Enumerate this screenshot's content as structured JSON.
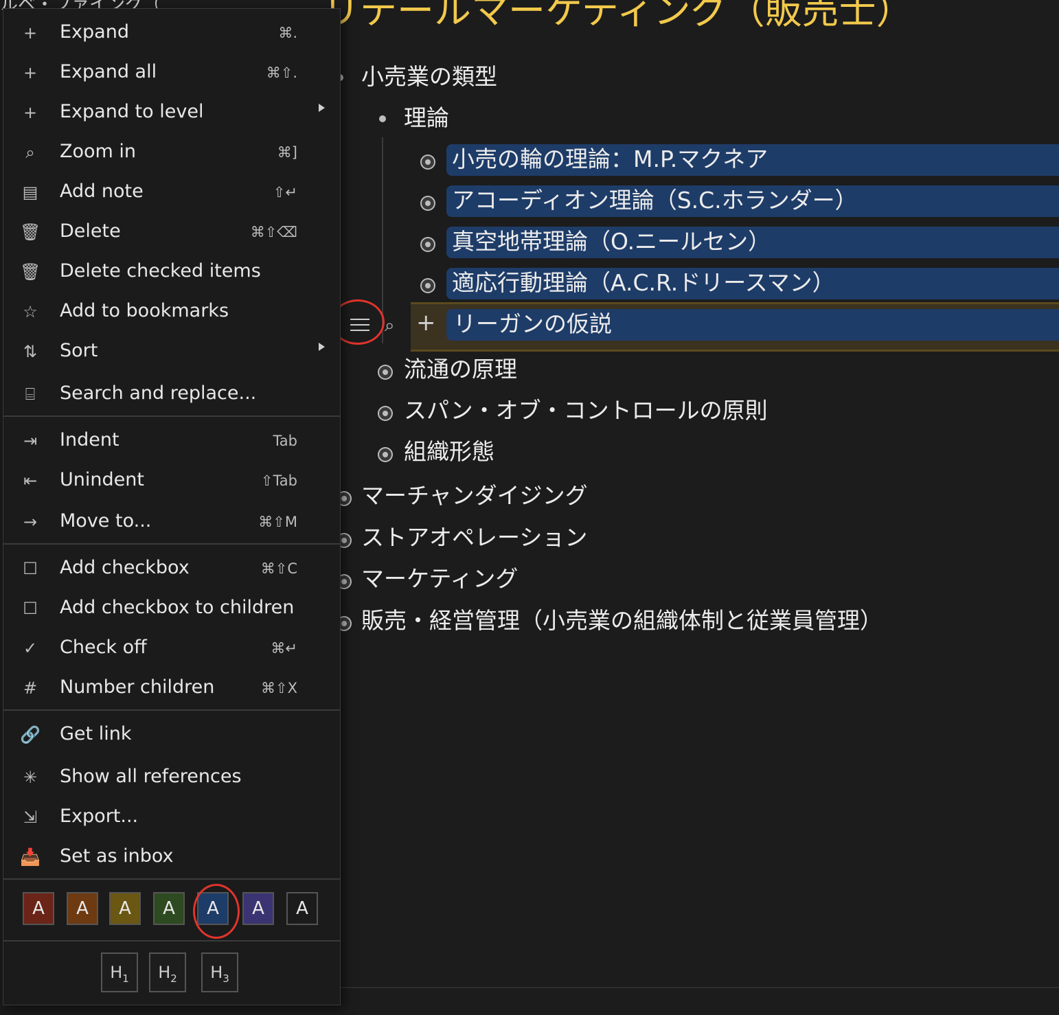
{
  "breadcrumb": "ルベ・ファイング（",
  "title": "リテールマーケティング（販売士）",
  "outline": {
    "root": "小売業の類型",
    "sub": "理論",
    "theories": [
      "小売の輪の理論：M.P.マクネア",
      "アコーディオン理論（S.C.ホランダー）",
      "真空地帯理論（O.ニールセン）",
      "適応行動理論（A.C.R.ドリースマン）"
    ],
    "selected": "リーガンの仮説",
    "siblings": [
      "流通の原理",
      "スパン・オブ・コントロールの原則",
      "組織形態"
    ],
    "top_items": [
      "マーチャンダイジング",
      "ストアオペレーション",
      "マーケティング",
      "販売・経営管理（小売業の組織体制と従業員管理）"
    ]
  },
  "menu": {
    "items": [
      {
        "icon": "+",
        "label": "Expand",
        "shortcut": "⌘.",
        "submenu": false
      },
      {
        "icon": "+",
        "label": "Expand all",
        "shortcut": "⌘⇧.",
        "submenu": false
      },
      {
        "icon": "+",
        "label": "Expand to level",
        "shortcut": "",
        "submenu": true
      },
      {
        "icon": "⌕",
        "label": "Zoom in",
        "shortcut": "⌘]",
        "submenu": false
      },
      {
        "icon": "▤",
        "label": "Add note",
        "shortcut": "⇧↵",
        "submenu": false
      },
      {
        "icon": "🗑",
        "label": "Delete",
        "shortcut": "⌘⇧⌫",
        "submenu": false
      },
      {
        "icon": "🗑",
        "label": "Delete checked items",
        "shortcut": "",
        "submenu": false
      },
      {
        "icon": "☆",
        "label": "Add to bookmarks",
        "shortcut": "",
        "submenu": false
      },
      {
        "icon": "⇅",
        "label": "Sort",
        "shortcut": "",
        "submenu": true
      },
      {
        "icon": "⌸",
        "label": "Search and replace...",
        "shortcut": "",
        "submenu": false
      },
      {
        "icon": "⇥",
        "label": "Indent",
        "shortcut": "Tab",
        "submenu": false
      },
      {
        "icon": "⇤",
        "label": "Unindent",
        "shortcut": "⇧Tab",
        "submenu": false
      },
      {
        "icon": "→",
        "label": "Move to...",
        "shortcut": "⌘⇧M",
        "submenu": false
      },
      {
        "icon": "☐",
        "label": "Add checkbox",
        "shortcut": "⌘⇧C",
        "submenu": false
      },
      {
        "icon": "☐",
        "label": "Add checkbox to children",
        "shortcut": "",
        "submenu": false
      },
      {
        "icon": "✓",
        "label": "Check off",
        "shortcut": "⌘↵",
        "submenu": false
      },
      {
        "icon": "#",
        "label": "Number children",
        "shortcut": "⌘⇧X",
        "submenu": false
      },
      {
        "icon": "🔗",
        "label": "Get link",
        "shortcut": "",
        "submenu": false
      },
      {
        "icon": "✳",
        "label": "Show all references",
        "shortcut": "",
        "submenu": false
      },
      {
        "icon": "⇲",
        "label": "Export...",
        "shortcut": "",
        "submenu": false
      },
      {
        "icon": "📥",
        "label": "Set as inbox",
        "shortcut": "",
        "submenu": false
      }
    ],
    "color_swatches": [
      {
        "label": "A",
        "bg": "#6b2418"
      },
      {
        "label": "A",
        "bg": "#6e3a12"
      },
      {
        "label": "A",
        "bg": "#6a5713"
      },
      {
        "label": "A",
        "bg": "#2e4a20"
      },
      {
        "label": "A",
        "bg": "#1e3c68"
      },
      {
        "label": "A",
        "bg": "#3b3472"
      },
      {
        "label": "A",
        "bg": "#1b1b1b"
      }
    ],
    "headings": [
      {
        "main": "H",
        "sub": "1"
      },
      {
        "main": "H",
        "sub": "2"
      },
      {
        "main": "H",
        "sub": "3"
      }
    ]
  }
}
